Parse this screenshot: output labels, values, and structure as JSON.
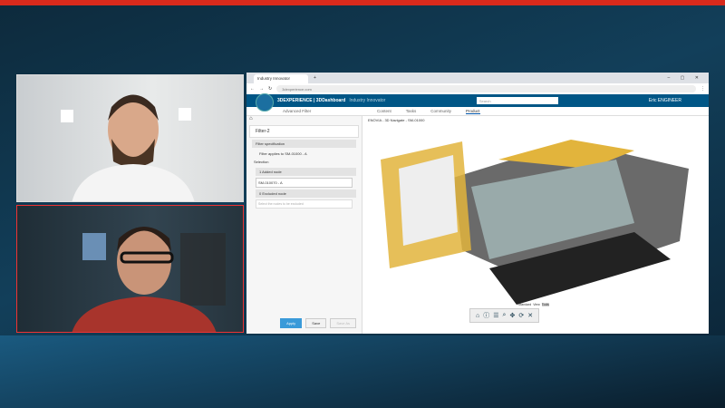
{
  "browser": {
    "tab_title": "Industry Innovator",
    "url": "3dexperience.com",
    "window_controls": "– ▢ ✕"
  },
  "app": {
    "brand": "3DEXPERIENCE | 3DDashboard",
    "dashboard": "Industry Innovator",
    "search_placeholder": "Search",
    "user": "Eric ENGINEER"
  },
  "panel": {
    "title": "Advanced Filter",
    "filter_name": "Filter-2",
    "spec": "Filter specification",
    "applies": "Filter applies to SM-01000 - A",
    "selection": "Selection",
    "added": "1 Added node",
    "added_value": "SM-010070 - A",
    "excluded": "0 Excluded node",
    "excluded_placeholder": "Select the nodes to be excluded",
    "apply": "Apply",
    "save": "Save",
    "save_as": "Save As"
  },
  "tabs": [
    "Content",
    "Tasks",
    "Community",
    "Product"
  ],
  "viewer": {
    "title": "ENOVIA - 3D Navigate - SM-01000",
    "modes": [
      "Standard",
      "View",
      "Tools"
    ]
  }
}
